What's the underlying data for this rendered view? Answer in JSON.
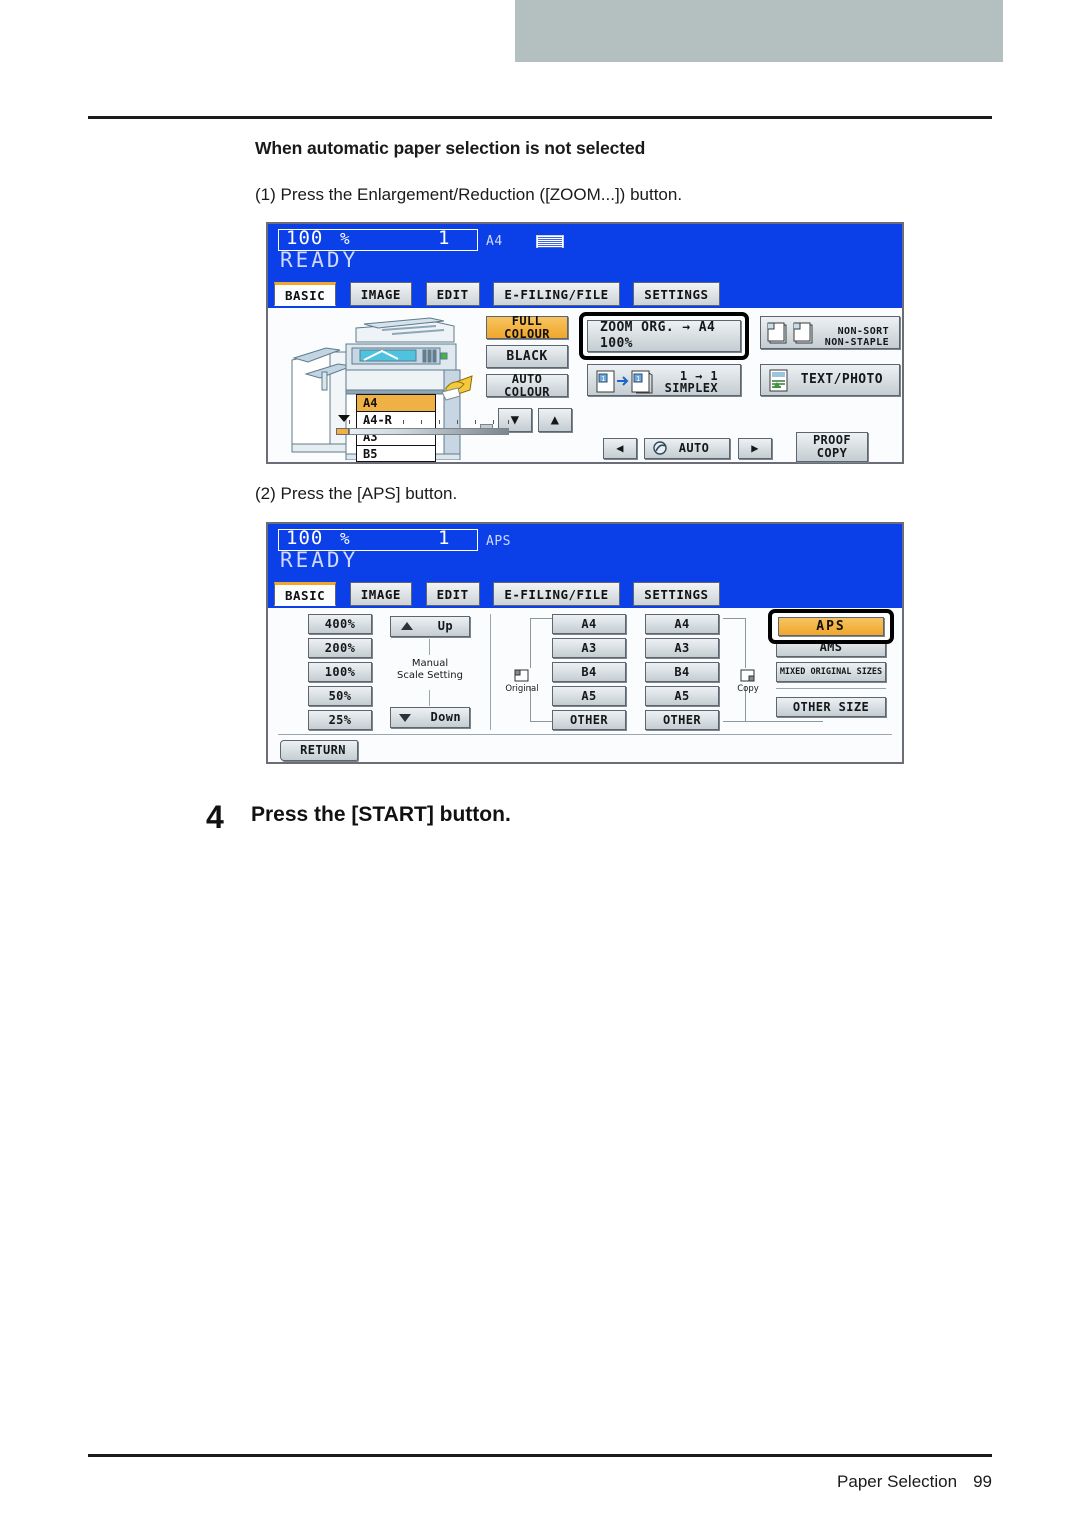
{
  "document": {
    "section_heading": "When automatic paper selection is not selected",
    "substep_1": "(1) Press the Enlargement/Reduction ([ZOOM...]) button.",
    "substep_2": "(2) Press the [APS] button.",
    "step_number": "4",
    "step_text": "Press the [START] button.",
    "footer_title": "Paper Selection",
    "footer_page": "99"
  },
  "colors": {
    "header_bar": "#b4c0c0",
    "panel_blue": "#0b3fe8",
    "tab_accent": "#f2a72c",
    "selected_button": "#f0b144",
    "highlight_ring": "#000000"
  },
  "panel1": {
    "status": {
      "ratio": "100",
      "percent": "%",
      "copies": "1",
      "paper_size": "A4",
      "tray_icon": "paper-stack-icon",
      "ready": "READY"
    },
    "tabs": [
      {
        "label": "BASIC",
        "active": true
      },
      {
        "label": "IMAGE",
        "active": false
      },
      {
        "label": "EDIT",
        "active": false
      },
      {
        "label": "E-FILING/FILE",
        "active": false
      },
      {
        "label": "SETTINGS",
        "active": false
      }
    ],
    "trays": [
      {
        "label": "A4",
        "selected": true
      },
      {
        "label": "A4-R",
        "selected": false
      },
      {
        "label": "A3",
        "selected": false
      },
      {
        "label": "B5",
        "selected": false
      }
    ],
    "color_modes": [
      {
        "label": "FULL COLOUR",
        "selected": true
      },
      {
        "label": "BLACK",
        "selected": false
      },
      {
        "label": "AUTO COLOUR",
        "selected": false
      }
    ],
    "zoom_button": {
      "line1": "ZOOM   ORG. → A4",
      "line2": "100%",
      "highlighted": true
    },
    "duplex_button": {
      "line1": "1 → 1",
      "line2": "SIMPLEX"
    },
    "finishing_button": {
      "line1": "NON-SORT",
      "line2": "NON-STAPLE"
    },
    "original_mode_button": "TEXT/PHOTO",
    "density": {
      "left_arrow": "◀",
      "auto_label": "AUTO",
      "right_arrow": "▶"
    },
    "proof_copy_button": {
      "line1": "PROOF",
      "line2": "COPY"
    },
    "arrow_down": "▼",
    "arrow_up": "▲"
  },
  "panel2": {
    "status": {
      "ratio": "100",
      "percent": "%",
      "copies": "1",
      "paper_size": "APS",
      "ready": "READY"
    },
    "tabs": [
      {
        "label": "BASIC",
        "active": true
      },
      {
        "label": "IMAGE",
        "active": false
      },
      {
        "label": "EDIT",
        "active": false
      },
      {
        "label": "E-FILING/FILE",
        "active": false
      },
      {
        "label": "SETTINGS",
        "active": false
      }
    ],
    "zoom_presets": [
      "400%",
      "200%",
      "100%",
      "50%",
      "25%"
    ],
    "manual_scale": {
      "up_label": "Up",
      "down_label": "Down",
      "caption_line1": "Manual",
      "caption_line2": "Scale Setting",
      "up_icon": "triangle-up-icon",
      "down_icon": "triangle-down-icon"
    },
    "original_column": {
      "caption": "Original",
      "icon": "original-page-icon",
      "sizes": [
        "A4",
        "A3",
        "B4",
        "A5",
        "OTHER"
      ]
    },
    "copy_column": {
      "caption": "Copy",
      "icon": "copy-page-icon",
      "sizes": [
        "A4",
        "A3",
        "B4",
        "A5",
        "OTHER"
      ]
    },
    "right_buttons": [
      {
        "label": "APS",
        "selected": true,
        "highlighted": true
      },
      {
        "label": "AMS",
        "selected": false,
        "highlighted": false
      },
      {
        "label": "MIXED ORIGINAL SIZES",
        "selected": false,
        "highlighted": false
      },
      {
        "label": "OTHER SIZE",
        "selected": false,
        "highlighted": false
      }
    ],
    "return_button": "RETURN"
  }
}
